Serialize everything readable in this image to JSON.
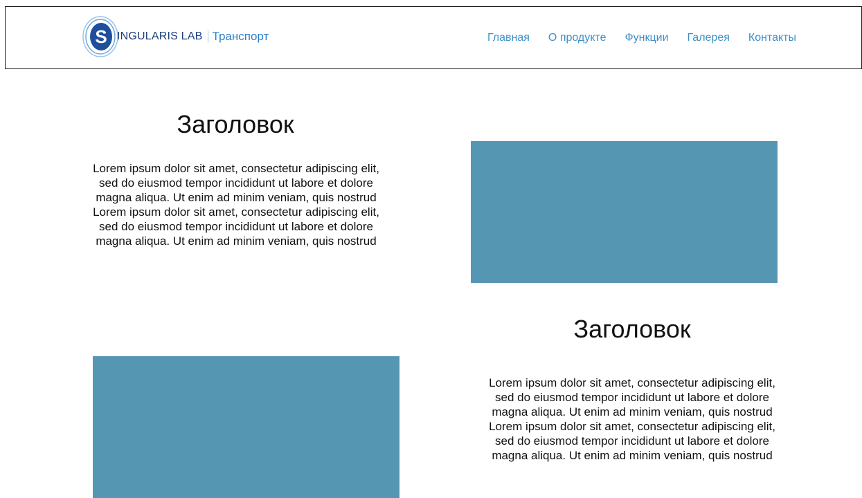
{
  "header": {
    "brand_name": "INGULARIS LAB",
    "brand_logo_letter": "S",
    "product_name": "Транспорт",
    "nav": [
      {
        "label": "Главная"
      },
      {
        "label": "О продукте"
      },
      {
        "label": "Функции"
      },
      {
        "label": "Галерея"
      },
      {
        "label": "Контакты"
      }
    ]
  },
  "sections": [
    {
      "title": "Заголовок",
      "text": "Lorem ipsum dolor sit amet, consectetur adipiscing elit, sed do eiusmod tempor incididunt ut labore et dolore magna aliqua. Ut enim ad minim veniam, quis nostrud Lorem ipsum dolor sit amet, consectetur adipiscing elit, sed do eiusmod tempor incididunt ut labore et dolore magna aliqua. Ut enim ad minim veniam, quis nostrud"
    },
    {
      "title": "Заголовок",
      "text": "Lorem ipsum dolor sit amet, consectetur adipiscing elit, sed do eiusmod tempor incididunt ut labore et dolore magna aliqua. Ut enim ad minim veniam, quis nostrud Lorem ipsum dolor sit amet, consectetur adipiscing elit, sed do eiusmod tempor incididunt ut labore et dolore magna aliqua. Ut enim ad minim veniam, quis nostrud"
    }
  ],
  "colors": {
    "placeholder": "#5597b3",
    "nav_link": "#3f8fc7",
    "brand": "#1c3f7a",
    "product": "#2a7fc9"
  }
}
